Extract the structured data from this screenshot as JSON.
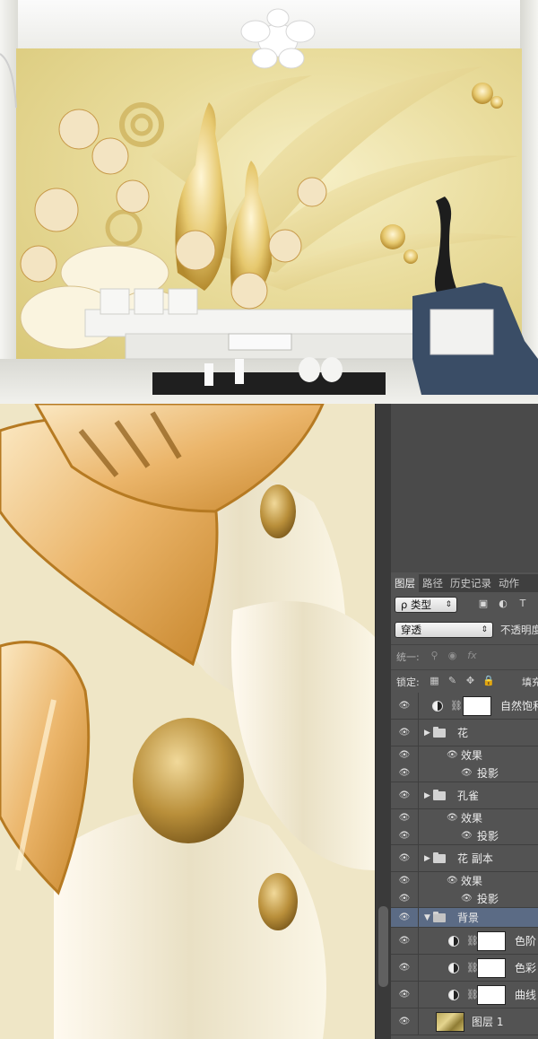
{
  "colors": {
    "panel_bg": "#535353",
    "panel_dark": "#4a4a4a",
    "tab_bar": "#3f3f3f",
    "selected_row": "#5b6b85",
    "mural_gold": "#e9dc9c"
  },
  "panel": {
    "tabs": [
      {
        "label": "图层"
      },
      {
        "label": "路径"
      },
      {
        "label": "历史记录"
      },
      {
        "label": "动作"
      }
    ],
    "filter": {
      "label": "ρ 类型",
      "icons": [
        "image-filter-icon",
        "adjustment-filter-icon",
        "type-filter-icon"
      ]
    },
    "type_icon_label": "T",
    "blend_mode": "穿透",
    "opacity_label": "不透明度",
    "unify_label": "统一:",
    "lock_label": "锁定:",
    "fill_label": "填充",
    "fx_label": "fx",
    "layers": [
      {
        "name": "自然饱和",
        "kind": "adjustment"
      },
      {
        "name": "花",
        "kind": "group"
      },
      {
        "name": "效果",
        "kind": "effects"
      },
      {
        "name": "投影",
        "kind": "effect"
      },
      {
        "name": "孔雀",
        "kind": "group"
      },
      {
        "name": "效果",
        "kind": "effects"
      },
      {
        "name": "投影",
        "kind": "effect"
      },
      {
        "name": "花 副本",
        "kind": "group"
      },
      {
        "name": "效果",
        "kind": "effects"
      },
      {
        "name": "投影",
        "kind": "effect"
      },
      {
        "name": "背景",
        "kind": "group-open",
        "selected": true
      },
      {
        "name": "色阶",
        "kind": "adjustment"
      },
      {
        "name": "色彩",
        "kind": "adjustment"
      },
      {
        "name": "曲线",
        "kind": "adjustment"
      },
      {
        "name": "图层 1",
        "kind": "pixel"
      }
    ]
  }
}
